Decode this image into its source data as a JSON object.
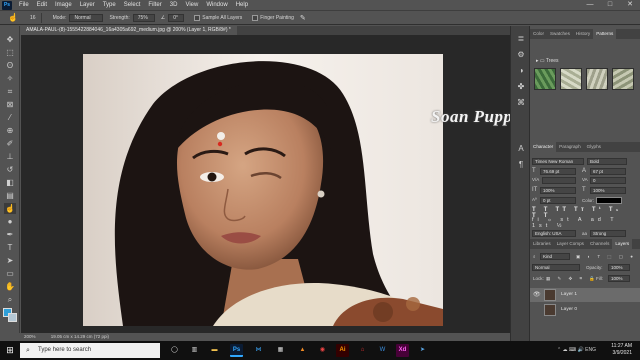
{
  "menu": {
    "logo": "Ps",
    "items": [
      "File",
      "Edit",
      "Image",
      "Layer",
      "Type",
      "Select",
      "Filter",
      "3D",
      "View",
      "Window",
      "Help"
    ],
    "window_controls": [
      "—",
      "□",
      "✕"
    ]
  },
  "options_bar": {
    "brush_size": "16",
    "mode_label": "Mode:",
    "mode_value": "Normal",
    "strength_label": "Strength:",
    "strength_value": "75%",
    "angle_value": "0°",
    "sample_all_layers": "Sample All Layers",
    "finger_painting": "Finger Painting"
  },
  "document_tab": "AMALA-PAUL-(8)-1555422884046_16a4305a692_medium.jpg @ 200% (Layer 1, RGB/8#) *",
  "watermark": "Soan Puppet",
  "status": {
    "zoom": "200%",
    "doc_size": "19.05 cm x 14.29 cm (72 ppi)"
  },
  "panels": {
    "top_tabs": [
      "Color",
      "Swatches",
      "History",
      "Patterns"
    ],
    "top_active": "Patterns",
    "folder_name": "Trees",
    "char_tabs": [
      "Character",
      "Paragraph",
      "Glyphs"
    ],
    "char_active": "Character",
    "font_family": "Times New Roman",
    "font_style": "Bold",
    "font_size": "76.69 pt",
    "leading": "67 pt",
    "kerning": "",
    "tracking": "0",
    "vscale": "100%",
    "hscale": "100%",
    "baseline": "0 pt",
    "color_label": "Color:",
    "language": "English: USA",
    "antialias": "Strong",
    "layer_tabs": [
      "Libraries",
      "Layer Comps",
      "Channels",
      "Layers"
    ],
    "layer_active": "Layers",
    "kind_label": "Kind",
    "blend_mode": "Normal",
    "opacity_label": "Opacity:",
    "opacity_value": "100%",
    "lock_label": "Lock:",
    "fill_label": "Fill:",
    "fill_value": "100%",
    "layers": [
      "Layer 1",
      "Layer 0"
    ]
  },
  "taskbar": {
    "search_placeholder": "Type here to search",
    "apps": [
      "Ps",
      "VS",
      "Ai",
      "Xd"
    ],
    "time": "11:27 AM",
    "date": "3/9/2021",
    "lang": "ENG"
  },
  "colors": {
    "foreground": "#2f9fd8",
    "background": "#b5c8d5",
    "accent": "#31a8ff"
  }
}
